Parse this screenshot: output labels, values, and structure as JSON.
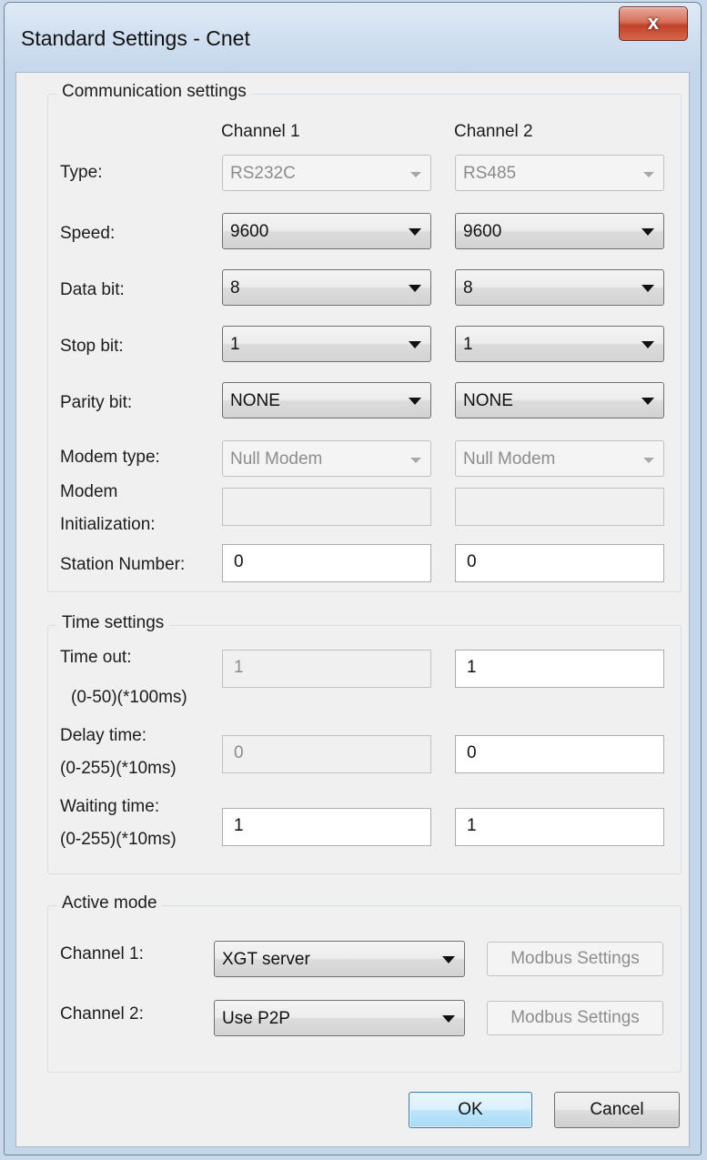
{
  "window": {
    "title": "Standard Settings - Cnet",
    "close_label": "x"
  },
  "communication": {
    "legend": "Communication settings",
    "channel1_header": "Channel 1",
    "channel2_header": "Channel 2",
    "rows": {
      "type": {
        "label": "Type:",
        "ch1": "RS232C",
        "ch2": "RS485"
      },
      "speed": {
        "label": "Speed:",
        "ch1": "9600",
        "ch2": "9600"
      },
      "data_bit": {
        "label": "Data bit:",
        "ch1": "8",
        "ch2": "8"
      },
      "stop_bit": {
        "label": "Stop bit:",
        "ch1": "1",
        "ch2": "1"
      },
      "parity_bit": {
        "label": "Parity bit:",
        "ch1": "NONE",
        "ch2": "NONE"
      },
      "modem_type": {
        "label": "Modem type:",
        "ch1": "Null Modem",
        "ch2": "Null Modem"
      },
      "modem_init": {
        "label_line1": "Modem",
        "label_line2": "Initialization:",
        "ch1": "",
        "ch2": ""
      },
      "station_number": {
        "label": "Station Number:",
        "ch1": "0",
        "ch2": "0"
      }
    }
  },
  "time": {
    "legend": "Time settings",
    "time_out": {
      "label": "Time out:",
      "range": "(0-50)(*100ms)",
      "ch1": "1",
      "ch2": "1"
    },
    "delay_time": {
      "label": "Delay time:",
      "range": "(0-255)(*10ms)",
      "ch1": "0",
      "ch2": "0"
    },
    "waiting_time": {
      "label": "Waiting time:",
      "range": "(0-255)(*10ms)",
      "ch1": "1",
      "ch2": "1"
    }
  },
  "active": {
    "legend": "Active mode",
    "channel1": {
      "label": "Channel 1:",
      "value": "XGT server",
      "button": "Modbus Settings"
    },
    "channel2": {
      "label": "Channel 2:",
      "value": "Use P2P",
      "button": "Modbus Settings"
    }
  },
  "buttons": {
    "ok": "OK",
    "cancel": "Cancel"
  }
}
